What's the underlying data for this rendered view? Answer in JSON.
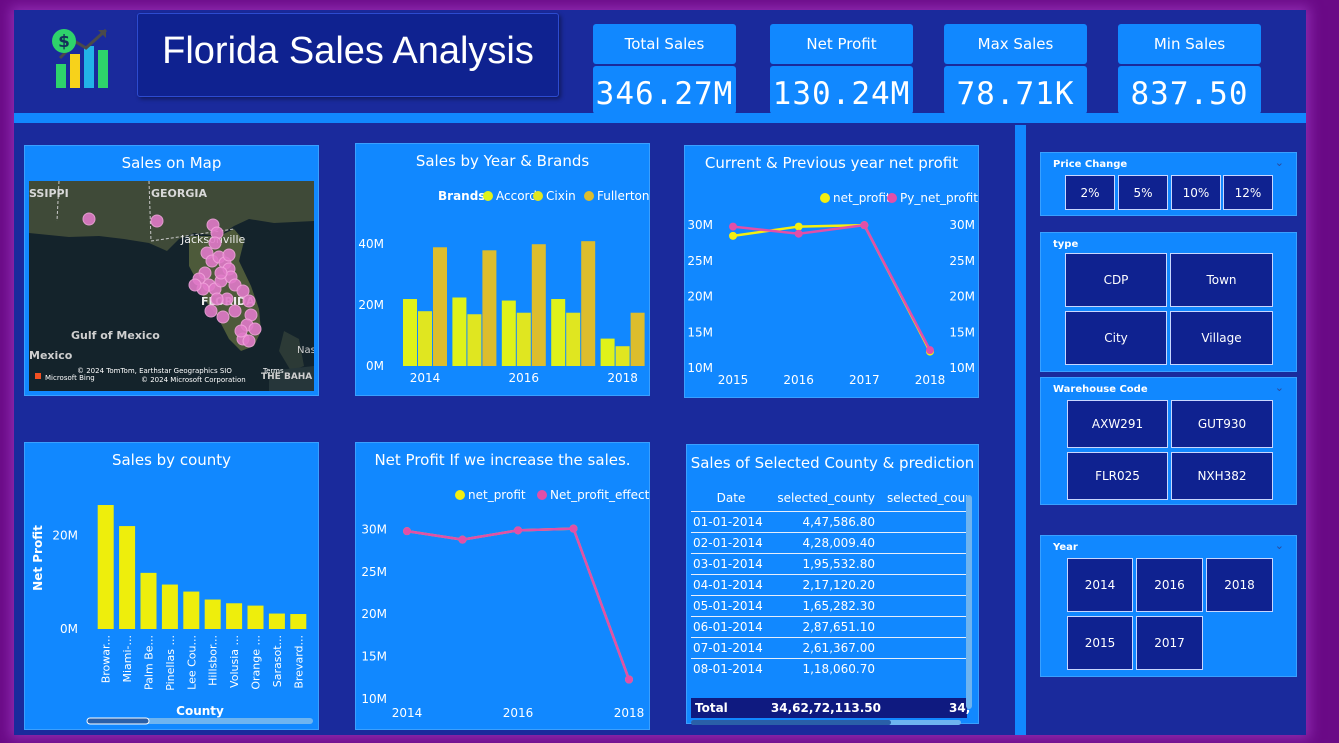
{
  "dashboard": {
    "title": "Florida Sales Analysis"
  },
  "kpis": [
    {
      "label": "Total Sales",
      "value": "346.27M"
    },
    {
      "label": "Net Profit",
      "value": "130.24M"
    },
    {
      "label": "Max Sales",
      "value": "78.71K"
    },
    {
      "label": "Min Sales",
      "value": "837.50"
    }
  ],
  "map": {
    "title": "Sales on Map",
    "labels": {
      "mississippi": "SSIPPI",
      "georgia": "GEORGIA",
      "jacksonville": "Jacksonville",
      "florida": "FLORIDA",
      "gulf": "Gulf of Mexico",
      "mexico": "Mexico",
      "nassau": "Nas",
      "bahamas": "THE BAHA",
      "bing": "Microsoft Bing",
      "copyright1": "© 2024 TomTom, Earthstar Geographics SIO",
      "terms": "Terms",
      "copyright2": "© 2024 Microsoft Corporation"
    },
    "point_color": "#e07ac8"
  },
  "chart_data": [
    {
      "type": "bar",
      "title": "Sales by Year & Brands",
      "legend_title": "Brands",
      "legend_position": "top-right",
      "categories": [
        "2014",
        "2015",
        "2016",
        "2017",
        "2018"
      ],
      "x_tick_labels": [
        "2014",
        "",
        "2016",
        "",
        "2018"
      ],
      "series": [
        {
          "name": "Accord",
          "color": "#dff21a",
          "values": [
            22,
            22.5,
            21.5,
            22,
            9
          ]
        },
        {
          "name": "Cixin",
          "color": "#e0e620",
          "values": [
            18,
            17,
            17.5,
            17.5,
            6.5
          ]
        },
        {
          "name": "Fullerton",
          "color": "#ddbd2d",
          "values": [
            39,
            38,
            40,
            41,
            17.5
          ]
        }
      ],
      "y_ticks": [
        "0M",
        "20M",
        "40M"
      ],
      "ylim": [
        0,
        45
      ]
    },
    {
      "type": "line",
      "title": "Current & Previous year net profit",
      "legend_position": "top-right",
      "categories": [
        "2015",
        "2016",
        "2017",
        "2018"
      ],
      "series": [
        {
          "name": "net_profit",
          "color": "#f4ee10",
          "values": [
            28.5,
            29.8,
            30,
            12.3
          ]
        },
        {
          "name": "Py_net_profit",
          "color": "#e24fa8",
          "values": [
            29.8,
            28.8,
            30,
            12.5
          ]
        }
      ],
      "y_ticks": [
        "10M",
        "15M",
        "20M",
        "25M",
        "30M"
      ],
      "ylim": [
        10,
        31
      ]
    },
    {
      "type": "bar",
      "title": "Sales by county",
      "xlabel": "County",
      "ylabel": "Net Profit",
      "categories": [
        "Browar...",
        "Miami-...",
        "Palm Be...",
        "Pinellas ...",
        "Lee Cou...",
        "Hillsbor...",
        "Volusia ...",
        "Orange ...",
        "Sarasot...",
        "Brevard..."
      ],
      "series": [
        {
          "name": "Net Profit",
          "color": "#eeee0c",
          "values": [
            26.5,
            22,
            12,
            9.5,
            8,
            6.3,
            5.5,
            5,
            3.3,
            3.2
          ]
        }
      ],
      "y_ticks": [
        "0M",
        "20M"
      ],
      "ylim": [
        0,
        28
      ]
    },
    {
      "type": "line",
      "title": "Net Profit If we increase the sales.",
      "legend_position": "top-right",
      "categories": [
        "2014",
        "2015",
        "2016",
        "2017",
        "2018"
      ],
      "x_tick_labels": [
        "2014",
        "",
        "2016",
        "",
        "2018"
      ],
      "series": [
        {
          "name": "net_profit",
          "color": "#f4ee10",
          "values": [
            29.8,
            28.8,
            29.9,
            30.1,
            12.3
          ]
        },
        {
          "name": "Net_profit_effect",
          "color": "#e24fa8",
          "values": [
            29.8,
            28.8,
            29.9,
            30.1,
            12.3
          ]
        }
      ],
      "y_ticks": [
        "10M",
        "15M",
        "20M",
        "25M",
        "30M"
      ],
      "ylim": [
        10,
        31
      ]
    },
    {
      "type": "table",
      "title": "Sales of Selected County & prediction",
      "columns": [
        "Date",
        "selected_county",
        "selected_coun"
      ],
      "rows": [
        [
          "01-01-2014",
          "4,47,586.80",
          ""
        ],
        [
          "02-01-2014",
          "4,28,009.40",
          ""
        ],
        [
          "03-01-2014",
          "1,95,532.80",
          ""
        ],
        [
          "04-01-2014",
          "2,17,120.20",
          ""
        ],
        [
          "05-01-2014",
          "1,65,282.30",
          ""
        ],
        [
          "06-01-2014",
          "2,87,651.10",
          ""
        ],
        [
          "07-01-2014",
          "2,61,367.00",
          ""
        ],
        [
          "08-01-2014",
          "1,18,060.70",
          ""
        ]
      ],
      "total": [
        "Total",
        "34,62,72,113.50",
        "34,"
      ]
    }
  ],
  "slicers": {
    "price_change": {
      "label": "Price Change",
      "options": [
        "2%",
        "5%",
        "10%",
        "12%"
      ]
    },
    "type": {
      "label": "type",
      "options": [
        "CDP",
        "Town",
        "City",
        "Village"
      ]
    },
    "warehouse": {
      "label": "Warehouse Code",
      "options": [
        "AXW291",
        "GUT930",
        "FLR025",
        "NXH382"
      ]
    },
    "year": {
      "label": "Year",
      "options": [
        "2014",
        "2016",
        "2018",
        "2015",
        "2017"
      ]
    }
  },
  "colors": {
    "background": "#1a2a9c",
    "panel": "#1188ff",
    "accent": "#6a0a86"
  }
}
